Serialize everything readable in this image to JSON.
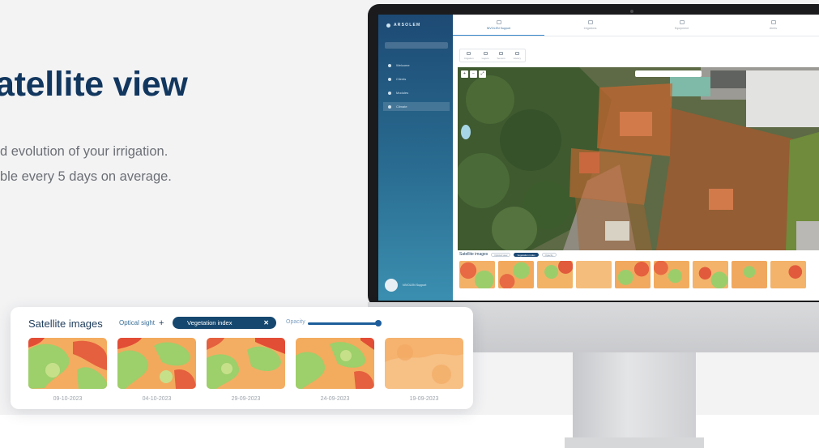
{
  "headline": "atellite view",
  "description": {
    "line1": "d evolution of your irrigation.",
    "line2": "ble every 5 days on average."
  },
  "app": {
    "brand": "ARSOLEM",
    "sidebar": {
      "items": [
        {
          "label": "Welcome",
          "icon": "home-icon"
        },
        {
          "label": "Clients",
          "icon": "user-icon"
        },
        {
          "label": "Modules",
          "icon": "module-icon"
        },
        {
          "label": "Climate",
          "icon": "cloud-icon"
        }
      ]
    },
    "nav_tabs": [
      {
        "label": "NIVOLEN Support",
        "active": true
      },
      {
        "label": "Irrigations"
      },
      {
        "label": "Equipment"
      },
      {
        "label": "Alerts"
      }
    ],
    "toolbar": [
      "Irrigation",
      "Layers",
      "Sectors",
      "History"
    ],
    "map": {
      "ctrl_labels": [
        "+",
        "−",
        "⤢"
      ]
    },
    "strip": {
      "title": "Satellite images",
      "pills": [
        "Optical view",
        "Vegetation index",
        "Opacity"
      ]
    }
  },
  "card": {
    "title": "Satellite images",
    "optical_sight": "Optical sight",
    "vegetation_index": "Vegetation index",
    "opacity": "Opacity",
    "opacity_level": 1.0,
    "thumbnails": [
      {
        "date": "09-10-2023",
        "style": "vegetation"
      },
      {
        "date": "04-10-2023",
        "style": "vegetation"
      },
      {
        "date": "29-09-2023",
        "style": "vegetation"
      },
      {
        "date": "24-09-2023",
        "style": "vegetation"
      },
      {
        "date": "19-09-2023",
        "style": "cloudy"
      }
    ]
  },
  "colors": {
    "headline": "#12375f",
    "pill": "#16486f",
    "sidebar": "#1d4a74",
    "veg_green": "#9ccd6b",
    "veg_orange": "#f3a45a",
    "veg_red": "#e7583e"
  }
}
